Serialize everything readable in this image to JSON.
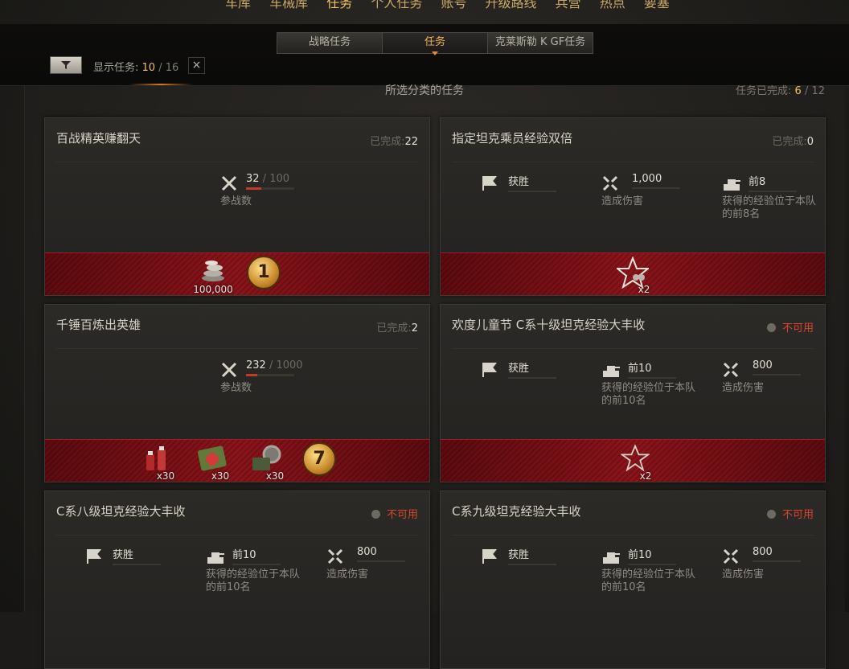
{
  "topnav": [
    "车库",
    "车械库",
    "任务",
    "个人任务",
    "账号",
    "升级路线",
    "兵营",
    "热点",
    "要塞"
  ],
  "tabs": [
    {
      "label": "战略任务",
      "active": false
    },
    {
      "label": "任务",
      "active": true
    },
    {
      "label": "克莱斯勒 K GF任务",
      "active": false
    }
  ],
  "filter": {
    "label": "显示任务: ",
    "shown": "10",
    "sep": " / ",
    "total": "16",
    "close": "×"
  },
  "section_title": "所选分类的任务",
  "progress": {
    "label": "任务已完成: ",
    "done": "6",
    "sep": " / ",
    "total": "12"
  },
  "cards": [
    {
      "title": "百战精英赚翻天",
      "status_label": "已完成:",
      "status_count": "22",
      "progress": {
        "value": "32",
        "sep": " / ",
        "total": "100",
        "desc": "参战数",
        "fraction": 0.32
      },
      "rewards": [
        {
          "icon": "credits-icon",
          "amount": "100,000"
        },
        {
          "icon": "medal-1-icon",
          "amount": ""
        }
      ]
    },
    {
      "title": "指定坦克乘员经验双倍",
      "status_label": "已完成:",
      "status_count": "0",
      "conditions": [
        {
          "icon": "flag-icon",
          "value": "获胜",
          "desc": ""
        },
        {
          "icon": "damage-icon",
          "value": "1,000",
          "desc": "造成伤害"
        },
        {
          "icon": "tank-rank-icon",
          "value": "前8",
          "desc": "获得的经验位于本队的前8名"
        }
      ],
      "rewards": [
        {
          "icon": "crew-xp-star-icon",
          "amount": "x2"
        }
      ]
    },
    {
      "title": "千锤百炼出英雄",
      "status_label": "已完成:",
      "status_count": "2",
      "progress": {
        "value": "232",
        "sep": " / ",
        "total": "1000",
        "desc": "参战数",
        "fraction": 0.232
      },
      "rewards": [
        {
          "icon": "repair-kit-icon",
          "amount": "x30"
        },
        {
          "icon": "first-aid-kit-icon",
          "amount": "x30"
        },
        {
          "icon": "toolbox-icon",
          "amount": "x30"
        },
        {
          "icon": "medal-7-icon",
          "amount": ""
        }
      ]
    },
    {
      "title": "欢度儿童节 C系十级坦克经验大丰收",
      "status_label": "不可用",
      "status_count": "",
      "conditions": [
        {
          "icon": "flag-icon",
          "value": "获胜",
          "desc": ""
        },
        {
          "icon": "tank-rank-icon",
          "value": "前10",
          "desc": "获得的经验位于本队的前10名"
        },
        {
          "icon": "damage-icon",
          "value": "800",
          "desc": "造成伤害"
        }
      ],
      "rewards": [
        {
          "icon": "xp-star-icon",
          "amount": "x2"
        }
      ]
    },
    {
      "title": "C系八级坦克经验大丰收",
      "status_label": "不可用",
      "status_count": "",
      "conditions": [
        {
          "icon": "flag-icon",
          "value": "获胜",
          "desc": ""
        },
        {
          "icon": "tank-rank-icon",
          "value": "前10",
          "desc": "获得的经验位于本队的前10名"
        },
        {
          "icon": "damage-icon",
          "value": "800",
          "desc": "造成伤害"
        }
      ]
    },
    {
      "title": "C系九级坦克经验大丰收",
      "status_label": "不可用",
      "status_count": "",
      "conditions": [
        {
          "icon": "flag-icon",
          "value": "获胜",
          "desc": ""
        },
        {
          "icon": "tank-rank-icon",
          "value": "前10",
          "desc": "获得的经验位于本队的前10名"
        },
        {
          "icon": "damage-icon",
          "value": "800",
          "desc": "造成伤害"
        }
      ]
    }
  ],
  "colors": {
    "accent": "#f0b25a",
    "unavailable": "#d8452c",
    "reward_band": "#8c141a"
  }
}
